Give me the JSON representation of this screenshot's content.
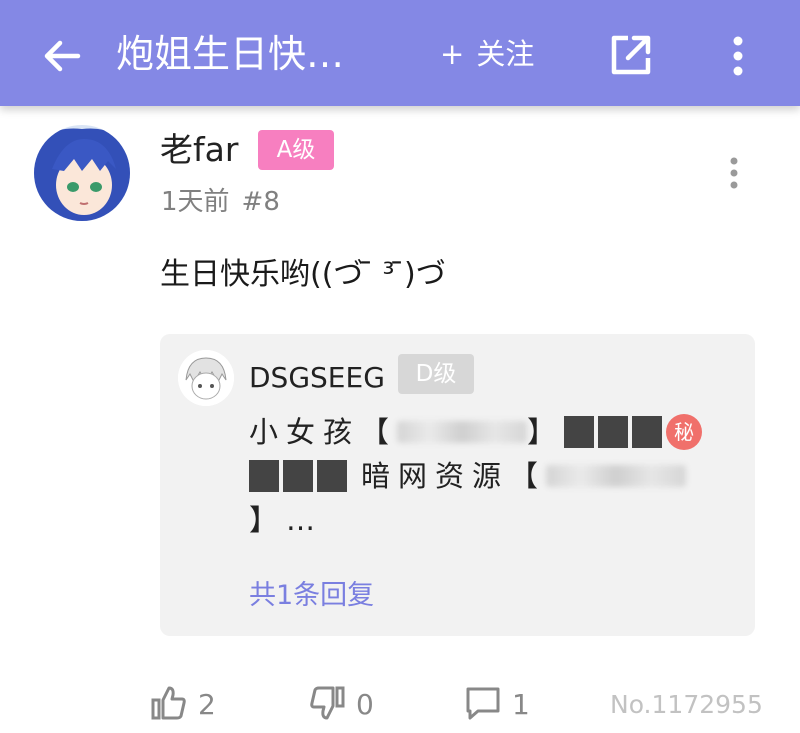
{
  "header": {
    "title": "炮姐生日快…",
    "follow_label": "关注",
    "follow_prefix": "+",
    "accent_color": "#8488e5"
  },
  "post": {
    "username": "老far",
    "level": "A级",
    "time_ago": "1天前",
    "floor": "#8",
    "content": "生日快乐哟((づ ̄ ³ ̄)づ"
  },
  "reply": {
    "username": "DSGSEEG",
    "level": "D级",
    "line1_a": "小女孩【",
    "line1_b": "】",
    "secret_badge": "秘",
    "line2_a": "暗网资源【",
    "line3_a": "】…",
    "reply_count": "共1条回复"
  },
  "actions": {
    "likes": "2",
    "dislikes": "0",
    "comments": "1",
    "post_id": "No.1172955"
  }
}
